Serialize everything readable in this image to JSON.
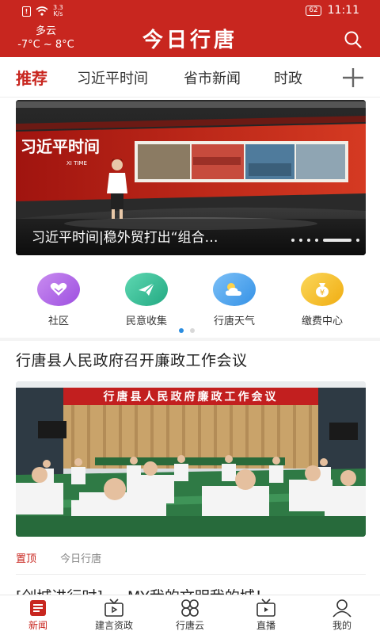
{
  "status_bar": {
    "network_speed": "3.3\nK/s",
    "battery": "62",
    "time": "11:11"
  },
  "header": {
    "weather_condition": "多云",
    "temperature": "-7°C ~ 8°C",
    "app_title": "今日行唐",
    "search_icon": "search-icon"
  },
  "tabs": [
    {
      "label": "推荐",
      "active": true
    },
    {
      "label": "习近平时间",
      "active": false
    },
    {
      "label": "省市新闻",
      "active": false
    },
    {
      "label": "时政",
      "active": false
    }
  ],
  "banner": {
    "caption": "习近平时间|稳外贸打出“组合…",
    "overlay_title": "习近平时间",
    "overlay_subtitle": "XI TIME",
    "active_slide": 5,
    "slide_count": 6
  },
  "quick_entries": [
    {
      "label": "社区",
      "icon": "heart-icon",
      "color": "#b06ae6"
    },
    {
      "label": "民意收集",
      "icon": "paper-plane-icon",
      "color": "#2fbf97"
    },
    {
      "label": "行唐天气",
      "icon": "weather-icon",
      "color": "#4ea6ef"
    },
    {
      "label": "缴费中心",
      "icon": "money-bag-icon",
      "color": "#f5c02a"
    }
  ],
  "quick_pager": {
    "active_page": 1,
    "page_count": 2
  },
  "news": [
    {
      "title": "行唐县人民政府召开廉政工作会议",
      "photo_banner": "行唐县人民政府廉政工作会议",
      "tag": "置顶",
      "source": "今日行唐"
    },
    {
      "title": "[创城进行时] 一 MY我的文明我的城！"
    }
  ],
  "bottom_nav": [
    {
      "label": "新闻",
      "icon": "news-icon",
      "active": true
    },
    {
      "label": "建言资政",
      "icon": "tv-icon",
      "active": false
    },
    {
      "label": "行唐云",
      "icon": "cloud-grid-icon",
      "active": false
    },
    {
      "label": "直播",
      "icon": "live-tv-icon",
      "active": false
    },
    {
      "label": "我的",
      "icon": "user-icon",
      "active": false
    }
  ],
  "colors": {
    "brand": "#c8261f",
    "accent": "#2b8de0"
  }
}
